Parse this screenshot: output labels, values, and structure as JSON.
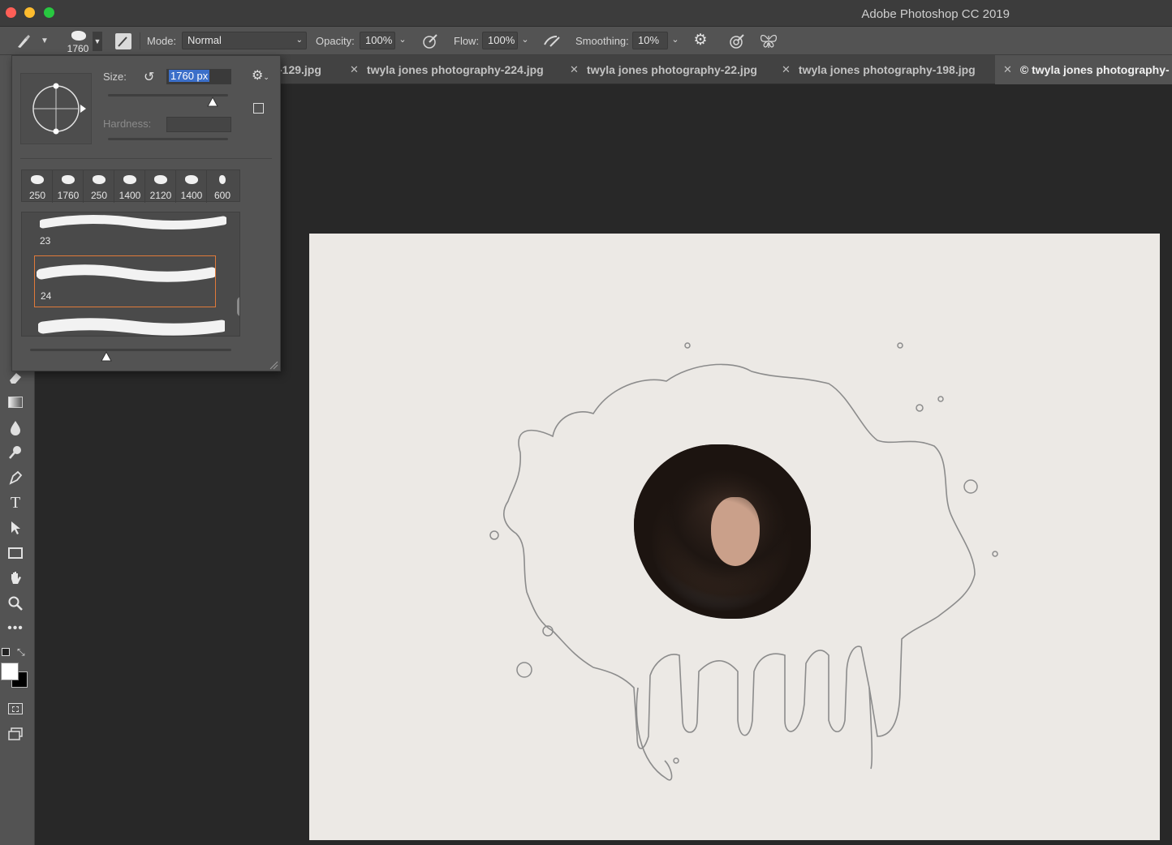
{
  "window": {
    "title": "Adobe Photoshop CC 2019"
  },
  "options_bar": {
    "brush_size": "1760",
    "mode_label": "Mode:",
    "mode_value": "Normal",
    "opacity_label": "Opacity:",
    "opacity_value": "100%",
    "flow_label": "Flow:",
    "flow_value": "100%",
    "smoothing_label": "Smoothing:",
    "smoothing_value": "10%"
  },
  "tabs": [
    {
      "label": "-129.jpg"
    },
    {
      "label": "twyla jones photography-224.jpg"
    },
    {
      "label": "twyla jones photography-22.jpg"
    },
    {
      "label": "twyla jones photography-198.jpg"
    },
    {
      "label": "© twyla jones photography-"
    }
  ],
  "brush_panel": {
    "size_label": "Size:",
    "size_value": "1760 px",
    "hardness_label": "Hardness:",
    "hardness_value": "",
    "size_slider_value": 0.87,
    "presets": [
      {
        "label": "250"
      },
      {
        "label": "1760"
      },
      {
        "label": "250"
      },
      {
        "label": "1400"
      },
      {
        "label": "2120"
      },
      {
        "label": "1400"
      },
      {
        "label": "600"
      }
    ],
    "brushes": [
      {
        "label": "23"
      },
      {
        "label": "24",
        "selected": true
      },
      {
        "label": ""
      }
    ]
  },
  "colors": {
    "accent_selection": "#e07a3a",
    "doc_background": "#ece9e5",
    "foreground": "#ffffff",
    "background_swatch": "#000000"
  },
  "icons": {
    "brush_tool": "paintbrush-icon",
    "settings": "gear-icon",
    "airbrush": "airbrush-icon",
    "pressure": "pressure-icon",
    "symmetry": "butterfly-icon"
  }
}
